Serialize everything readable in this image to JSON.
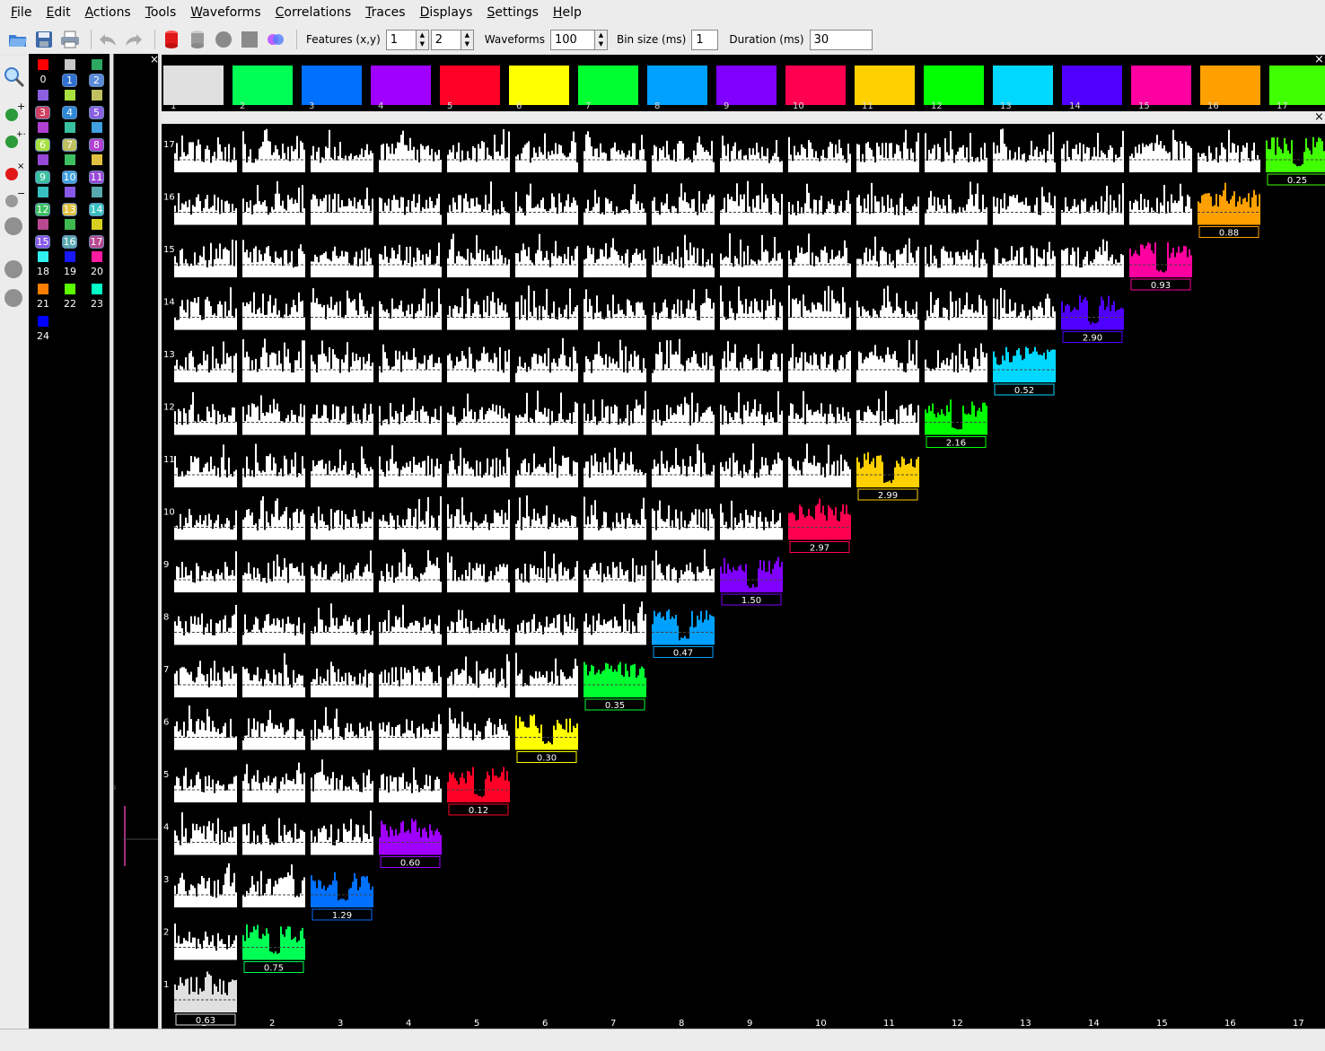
{
  "menu": [
    "File",
    "Edit",
    "Actions",
    "Tools",
    "Waveforms",
    "Correlations",
    "Traces",
    "Displays",
    "Settings",
    "Help"
  ],
  "toolbar": {
    "features_label": "Features (x,y)",
    "feature_x": "1",
    "feature_y": "2",
    "waveforms_label": "Waveforms",
    "waveforms_value": "100",
    "binsize_label": "Bin size (ms)",
    "binsize_value": "1",
    "duration_label": "Duration (ms)",
    "duration_value": "30"
  },
  "palette": {
    "colors": [
      "#ff0000",
      "#c8c8c8",
      "#2ca860",
      "#3070d0",
      "#5a8ad8",
      "#d04060",
      "#2e88d8",
      "#8a60e0",
      "#a8e040",
      "#c0c060",
      "#b040d0",
      "#38c0a0",
      "#40a0e0",
      "#9848d8",
      "#3cc060",
      "#e0c040",
      "#38c0c0",
      "#8858e8",
      "#58a8b0",
      "#b84890",
      "#40b850",
      "#d8d020",
      "#a8a840",
      "#48a8e0",
      "#d8a848",
      "#38a8d8",
      "#6848d8",
      "#30f0f0",
      "#1818ff",
      "#ff1ca0",
      "#ff7f00",
      "#5cff00",
      "#00ffc8",
      "#0000ff"
    ],
    "selected": [
      "1",
      "2",
      "3",
      "4",
      "5",
      "6",
      "7",
      "8",
      "9",
      "10",
      "11",
      "12",
      "13",
      "14",
      "15",
      "16",
      "17"
    ],
    "labels": [
      "0",
      "18",
      "19",
      "20",
      "21",
      "22",
      "23",
      "24"
    ]
  },
  "cluster_colors": [
    "#e0e0e0",
    "#00ff55",
    "#0070ff",
    "#a000ff",
    "#ff0026",
    "#ffff00",
    "#00ff30",
    "#00a0ff",
    "#8000ff",
    "#ff0050",
    "#ffd000",
    "#00ff00",
    "#00d8ff",
    "#5000ff",
    "#ff00a0",
    "#ffa000",
    "#40ff00"
  ],
  "clusters": [
    "1",
    "2",
    "3",
    "4",
    "5",
    "6",
    "7",
    "8",
    "9",
    "10",
    "11",
    "12",
    "13",
    "14",
    "15",
    "16",
    "17"
  ],
  "diagonal_values": [
    "0.63",
    "0.75",
    "1.29",
    "0.60",
    "0.12",
    "0.30",
    "0.35",
    "0.47",
    "1.50",
    "2.97",
    "2.99",
    "2.16",
    "0.52",
    "2.90",
    "0.93",
    "0.88",
    "0.25"
  ]
}
